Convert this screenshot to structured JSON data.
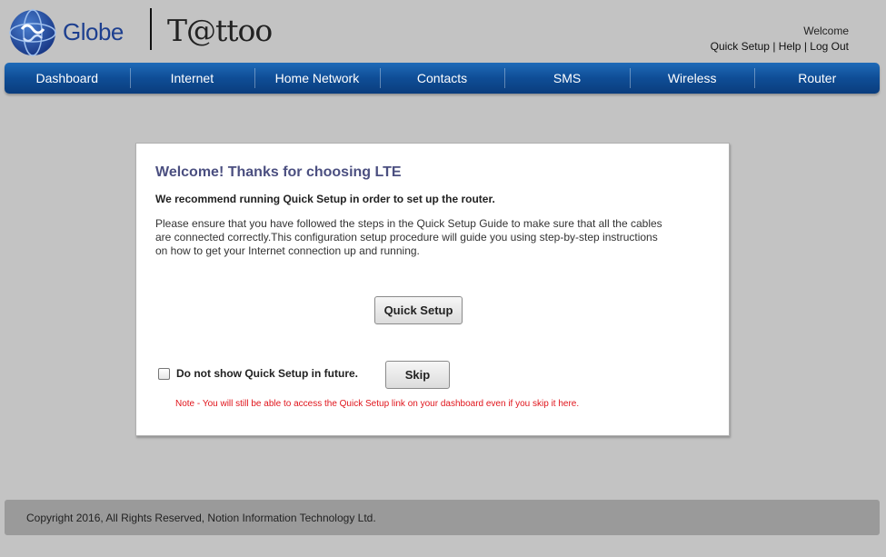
{
  "header": {
    "brand": "Globe",
    "product": "T@ttoo",
    "welcome": "Welcome",
    "links": {
      "quick_setup": "Quick Setup",
      "help": "Help",
      "logout": "Log Out",
      "separator": "|"
    }
  },
  "nav": {
    "items": [
      "Dashboard",
      "Internet",
      "Home Network",
      "Contacts",
      "SMS",
      "Wireless",
      "Router"
    ]
  },
  "panel": {
    "title": "Welcome! Thanks for choosing LTE",
    "subtitle": "We recommend running Quick Setup in order to set up the router.",
    "body": "Please ensure that you have followed the steps in the Quick Setup Guide to make sure that all the cables are connected correctly.This configuration setup procedure will guide you using step-by-step instructions on how to get your Internet connection up and running.",
    "quick_setup_button": "Quick Setup",
    "checkbox_label": "Do not show Quick Setup in future.",
    "checkbox_checked": false,
    "skip_button": "Skip",
    "note": "Note - You will still be able to access the Quick Setup link on your dashboard even if you skip it here."
  },
  "footer": {
    "copyright": "Copyright 2016, All Rights Reserved, Notion Information Technology Ltd."
  },
  "colors": {
    "nav_bg": "#0f4d96",
    "title": "#4b4f80",
    "note": "#e0141b",
    "page_bg": "#c3c3c3",
    "footer_bg": "#9a9a9a"
  },
  "icons": {
    "globe_logo": "globe-logo-icon",
    "tattoo_logo": "tattoo-logo-icon",
    "checkbox": "checkbox-icon"
  }
}
